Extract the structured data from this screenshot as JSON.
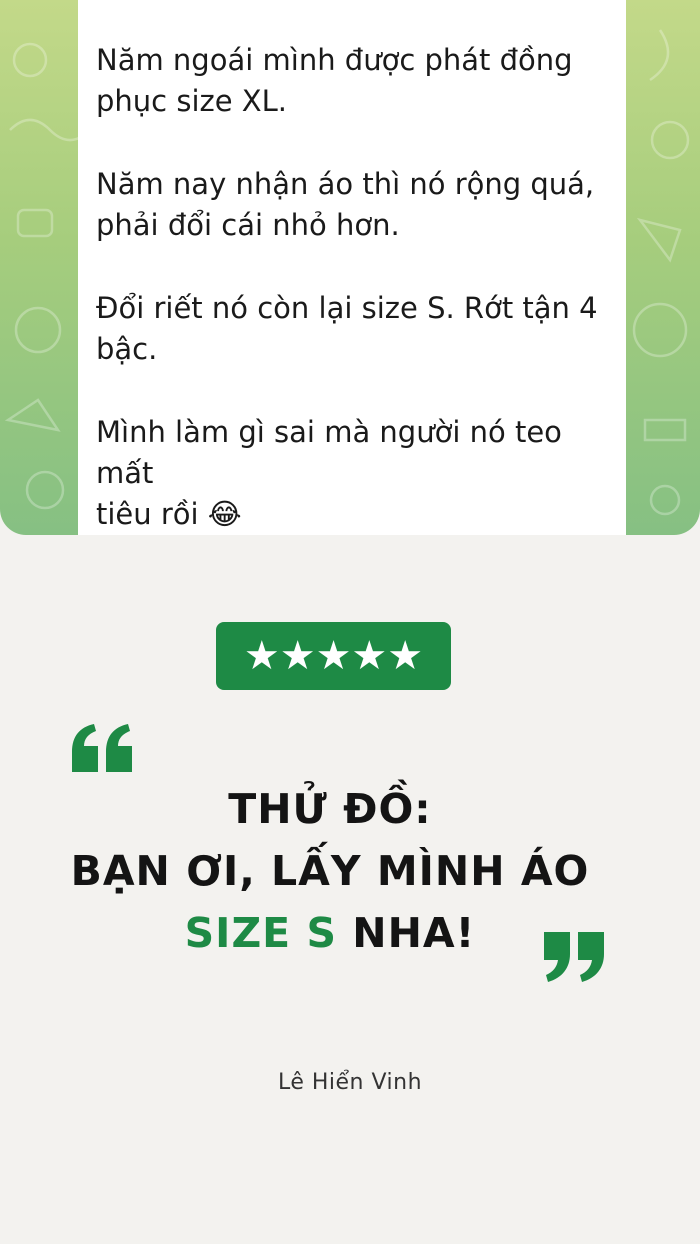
{
  "chat": {
    "messages": [
      "Năm ngoái mình được phát đồng\nphục size XL.",
      "Năm nay nhận áo thì nó rộng quá,\nphải đổi cái nhỏ hơn.",
      "Đổi riết nó còn lại size S. Rớt tận 4\nbậc.",
      "Mình làm gì sai mà người nó teo mất\ntiêu rồi 😂"
    ]
  },
  "rating": {
    "stars": "★★★★★",
    "value": 5,
    "max": 5
  },
  "headline": {
    "line1": "THỬ ĐỒ:",
    "line2": "BẠN ƠI, LẤY MÌNH ÁO",
    "line3_highlight": "SIZE S",
    "line3_rest": " NHA!"
  },
  "author": "Lê Hiển Vinh",
  "colors": {
    "accent": "#1e8a45",
    "background": "#f3f2ef",
    "chat_bg_top": "#c3d989",
    "chat_bg_bottom": "#86c083"
  },
  "icons": {
    "open_quote": "quote-open-icon",
    "close_quote": "quote-close-icon"
  }
}
